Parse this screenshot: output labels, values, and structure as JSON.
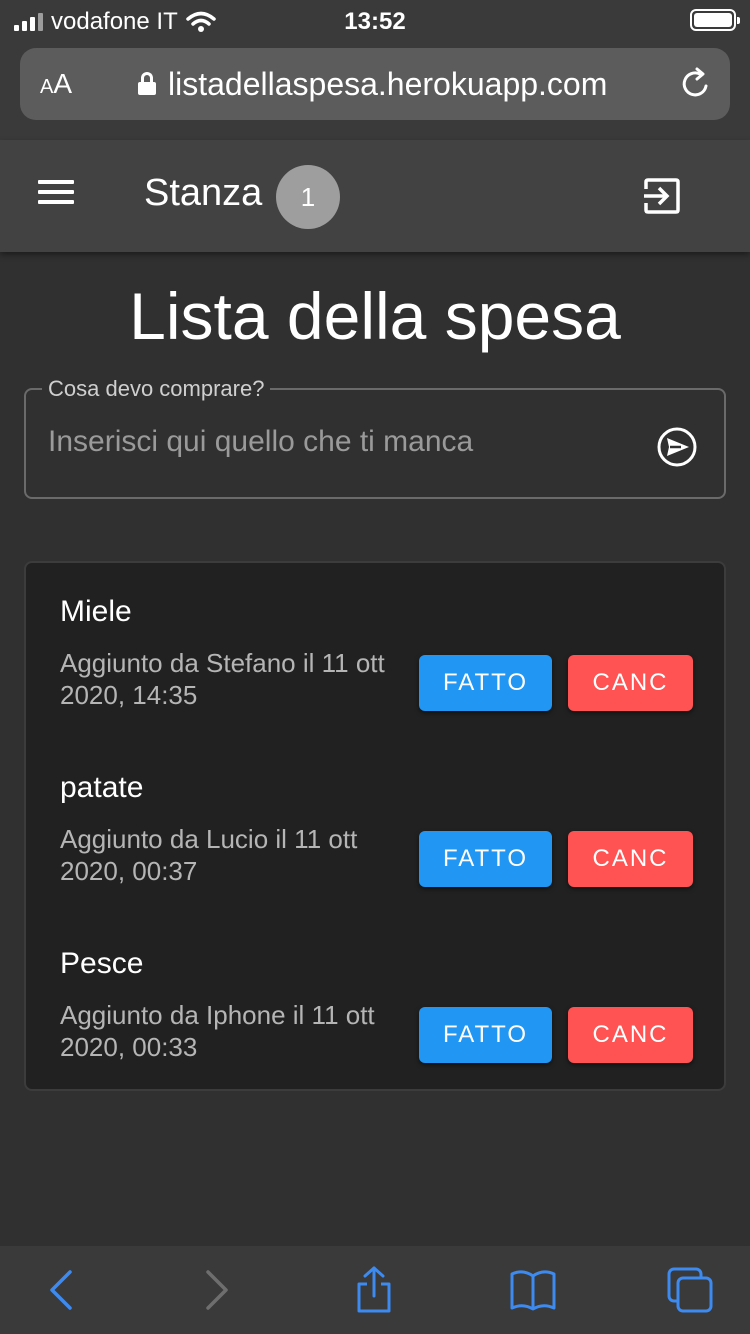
{
  "status_bar": {
    "carrier": "vodafone IT",
    "time": "13:52"
  },
  "browser": {
    "text_size_label_small": "A",
    "text_size_label_large": "A",
    "url": "listadellaspesa.herokuapp.com"
  },
  "app_bar": {
    "title": "Stanza",
    "room_number": "1"
  },
  "page": {
    "title": "Lista della spesa"
  },
  "input": {
    "label": "Cosa devo comprare?",
    "placeholder": "Inserisci qui quello che ti manca",
    "value": ""
  },
  "items": [
    {
      "name": "Miele",
      "meta": "Aggiunto da Stefano il 11 ott 2020, 14:35",
      "done_label": "FATTO",
      "delete_label": "CANC"
    },
    {
      "name": "patate",
      "meta": "Aggiunto da Lucio il 11 ott 2020, 00:37",
      "done_label": "FATTO",
      "delete_label": "CANC"
    },
    {
      "name": "Pesce",
      "meta": "Aggiunto da Iphone il 11 ott 2020, 00:33",
      "done_label": "FATTO",
      "delete_label": "CANC"
    }
  ],
  "colors": {
    "done_button": "#2196f3",
    "delete_button": "#ff5252",
    "browser_accent": "#3d8bf0"
  },
  "icons": {
    "menu": "hamburger-menu-icon",
    "logout": "exit-to-app-icon",
    "send": "send-circle-icon",
    "back": "chevron-left-icon",
    "forward": "chevron-right-icon",
    "share": "share-icon",
    "bookmarks": "book-icon",
    "tabs": "tabs-icon"
  }
}
